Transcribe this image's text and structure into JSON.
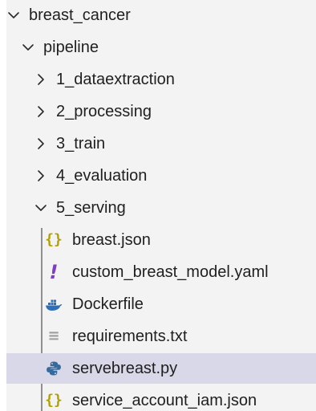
{
  "tree": {
    "root": {
      "label": "breast_cancer",
      "icon": "chevron-down-icon"
    },
    "pipeline": {
      "label": "pipeline",
      "icon": "chevron-down-icon"
    },
    "folders": [
      {
        "label": "1_dataextraction",
        "icon": "chevron-right-icon"
      },
      {
        "label": "2_processing",
        "icon": "chevron-right-icon"
      },
      {
        "label": "3_train",
        "icon": "chevron-right-icon"
      },
      {
        "label": "4_evaluation",
        "icon": "chevron-right-icon"
      }
    ],
    "serving": {
      "label": "5_serving",
      "icon": "chevron-down-icon"
    },
    "files": [
      {
        "label": "breast.json",
        "icon": "json-icon",
        "glyph": "{}"
      },
      {
        "label": "custom_breast_model.yaml",
        "icon": "yaml-icon",
        "glyph": "!"
      },
      {
        "label": "Dockerfile",
        "icon": "docker-icon"
      },
      {
        "label": "requirements.txt",
        "icon": "text-file-icon",
        "glyph": "≡"
      },
      {
        "label": "servebreast.py",
        "icon": "python-icon",
        "selected": true
      },
      {
        "label": "service_account_iam.json",
        "icon": "json-icon",
        "glyph": "{}"
      }
    ]
  },
  "colors": {
    "selected_background": "#d9d8e8",
    "json_icon": "#b29f00",
    "yaml_icon": "#7d3ec2",
    "docker_icon": "#2f6fb7",
    "python_icon": "#356a9c"
  }
}
